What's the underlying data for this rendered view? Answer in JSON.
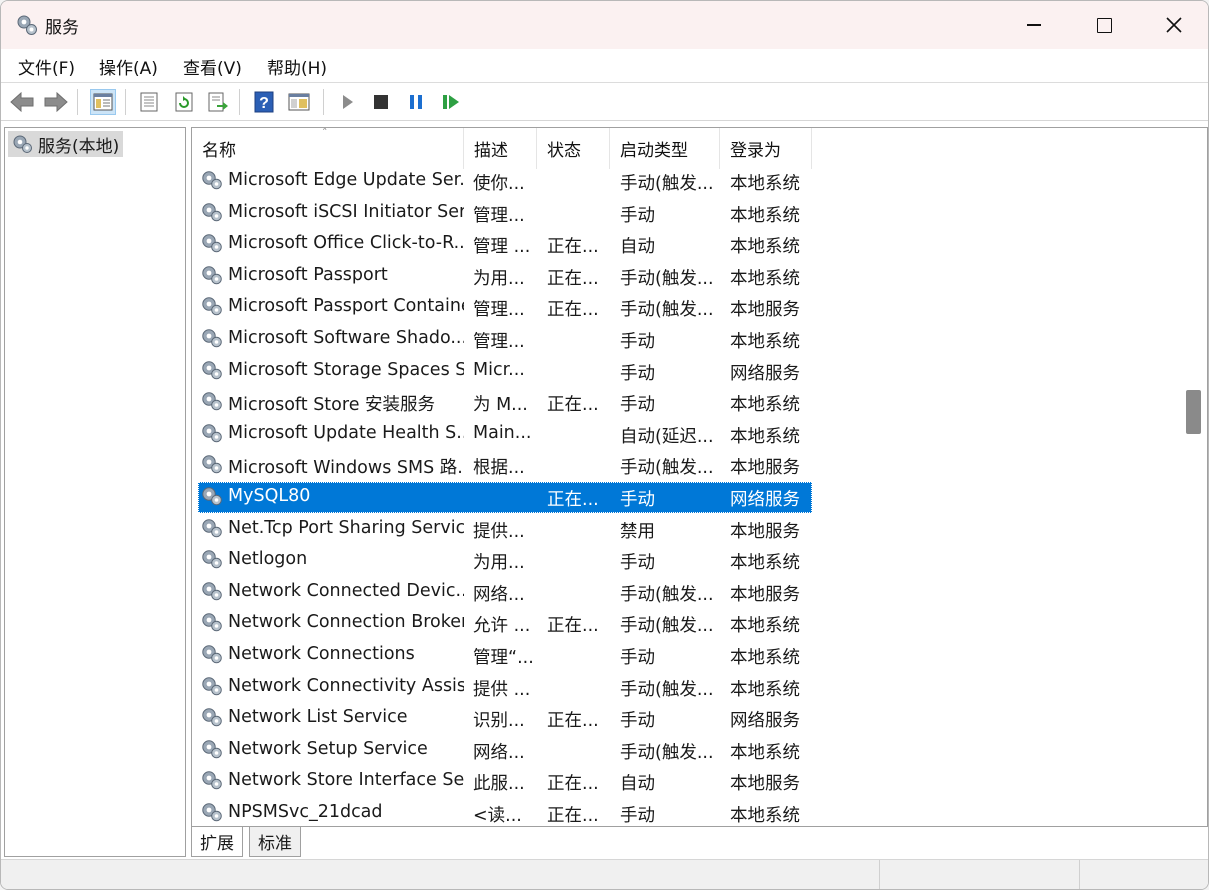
{
  "window": {
    "title": "服务"
  },
  "menu": [
    {
      "label": "文件(F)"
    },
    {
      "label": "操作(A)"
    },
    {
      "label": "查看(V)"
    },
    {
      "label": "帮助(H)"
    }
  ],
  "toolbar": {
    "buttons": [
      "back-icon",
      "forward-icon",
      "show-hide-tree-icon",
      "properties-icon",
      "refresh-icon",
      "export-list-icon",
      "help-icon",
      "console-view-icon",
      "start-service-icon",
      "stop-service-icon",
      "pause-service-icon",
      "resume-service-icon"
    ]
  },
  "tree": {
    "root_label": "服务(本地)"
  },
  "list": {
    "columns": [
      "名称",
      "描述",
      "状态",
      "启动类型",
      "登录为"
    ],
    "rows": [
      {
        "name": "Microsoft Edge Update Ser...",
        "desc": "使你...",
        "status": "",
        "start": "手动(触发...",
        "logon": "本地系统"
      },
      {
        "name": "Microsoft iSCSI Initiator Ser...",
        "desc": "管理...",
        "status": "",
        "start": "手动",
        "logon": "本地系统"
      },
      {
        "name": "Microsoft Office Click-to-R...",
        "desc": "管理 ...",
        "status": "正在...",
        "start": "自动",
        "logon": "本地系统"
      },
      {
        "name": "Microsoft Passport",
        "desc": "为用...",
        "status": "正在...",
        "start": "手动(触发...",
        "logon": "本地系统"
      },
      {
        "name": "Microsoft Passport Container",
        "desc": "管理...",
        "status": "正在...",
        "start": "手动(触发...",
        "logon": "本地服务"
      },
      {
        "name": "Microsoft Software Shado...",
        "desc": "管理...",
        "status": "",
        "start": "手动",
        "logon": "本地系统"
      },
      {
        "name": "Microsoft Storage Spaces S...",
        "desc": "Micr...",
        "status": "",
        "start": "手动",
        "logon": "网络服务"
      },
      {
        "name": "Microsoft Store 安装服务",
        "desc": "为 M...",
        "status": "正在...",
        "start": "手动",
        "logon": "本地系统"
      },
      {
        "name": "Microsoft Update Health S...",
        "desc": "Main...",
        "status": "",
        "start": "自动(延迟...",
        "logon": "本地系统"
      },
      {
        "name": "Microsoft Windows SMS 路...",
        "desc": "根据...",
        "status": "",
        "start": "手动(触发...",
        "logon": "本地服务"
      },
      {
        "name": "MySQL80",
        "desc": "",
        "status": "正在...",
        "start": "手动",
        "logon": "网络服务",
        "selected": true
      },
      {
        "name": "Net.Tcp Port Sharing Service",
        "desc": "提供...",
        "status": "",
        "start": "禁用",
        "logon": "本地服务"
      },
      {
        "name": "Netlogon",
        "desc": "为用...",
        "status": "",
        "start": "手动",
        "logon": "本地系统"
      },
      {
        "name": "Network Connected Devic...",
        "desc": "网络...",
        "status": "",
        "start": "手动(触发...",
        "logon": "本地服务"
      },
      {
        "name": "Network Connection Broker",
        "desc": "允许 ...",
        "status": "正在...",
        "start": "手动(触发...",
        "logon": "本地系统"
      },
      {
        "name": "Network Connections",
        "desc": "管理“...",
        "status": "",
        "start": "手动",
        "logon": "本地系统"
      },
      {
        "name": "Network Connectivity Assis...",
        "desc": "提供 ...",
        "status": "",
        "start": "手动(触发...",
        "logon": "本地系统"
      },
      {
        "name": "Network List Service",
        "desc": "识别...",
        "status": "正在...",
        "start": "手动",
        "logon": "网络服务"
      },
      {
        "name": "Network Setup Service",
        "desc": "网络...",
        "status": "",
        "start": "手动(触发...",
        "logon": "本地系统"
      },
      {
        "name": "Network Store Interface Se...",
        "desc": "此服...",
        "status": "正在...",
        "start": "自动",
        "logon": "本地服务"
      },
      {
        "name": "NPSMSvc_21dcad",
        "desc": "<读...",
        "status": "正在...",
        "start": "手动",
        "logon": "本地系统"
      }
    ]
  },
  "tabs": [
    {
      "label": "扩展"
    },
    {
      "label": "标准"
    }
  ],
  "colors": {
    "selection": "#0078d7",
    "titlebar": "#fbf1f1"
  }
}
